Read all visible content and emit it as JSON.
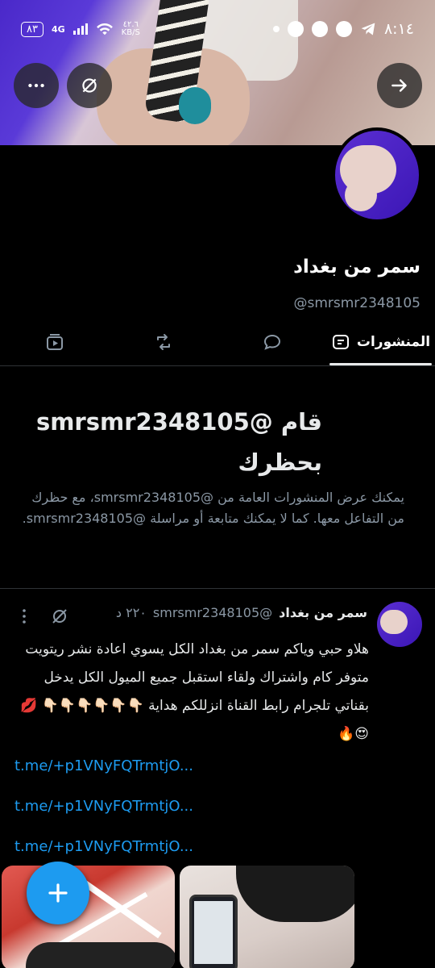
{
  "status_bar": {
    "battery": "٨٣",
    "network": "4G",
    "speed_value": "٤٢.٦",
    "speed_unit": "KB/S",
    "time": "٨:١٤"
  },
  "profile": {
    "name": "سمر من بغداد",
    "handle": "@smrsmr2348105"
  },
  "tabs": [
    {
      "label": "المنشورات",
      "icon": "posts-icon",
      "active": true
    },
    {
      "label": "",
      "icon": "reply-icon",
      "active": false
    },
    {
      "label": "",
      "icon": "retweet-icon",
      "active": false
    },
    {
      "label": "",
      "icon": "media-icon",
      "active": false
    }
  ],
  "blocked": {
    "title": "قام @smrsmr2348105 بحظرك",
    "description": "يمكنك عرض المنشورات العامة من @smrsmr2348105، مع حظرك من التفاعل معها. كما لا يمكنك متابعة أو مراسلة @smrsmr2348105."
  },
  "post": {
    "author": "سمر من بغداد",
    "handle": "@smrsmr2348105",
    "time": "٢٢٠ د",
    "text": "هلاو حبي وياكم سمر من بغداد الكل يسوي اعادة نشر ريتويت متوفر كام واشتراك ولقاء استقبل جميع الميول الكل يدخل بقناتي تلجرام رابط القناة انزللكم هداية 👇🏻👇🏻👇🏻👇🏻👇🏻👇🏻 💋😍🔥",
    "links": [
      "t.me/+p1VNyFQTrmtjO...",
      "t.me/+p1VNyFQTrmtjO...",
      "t.me/+p1VNyFQTrmtjO..."
    ]
  },
  "colors": {
    "accent": "#1d9bf0",
    "background": "#000000",
    "secondary_text": "#8b98a5"
  }
}
